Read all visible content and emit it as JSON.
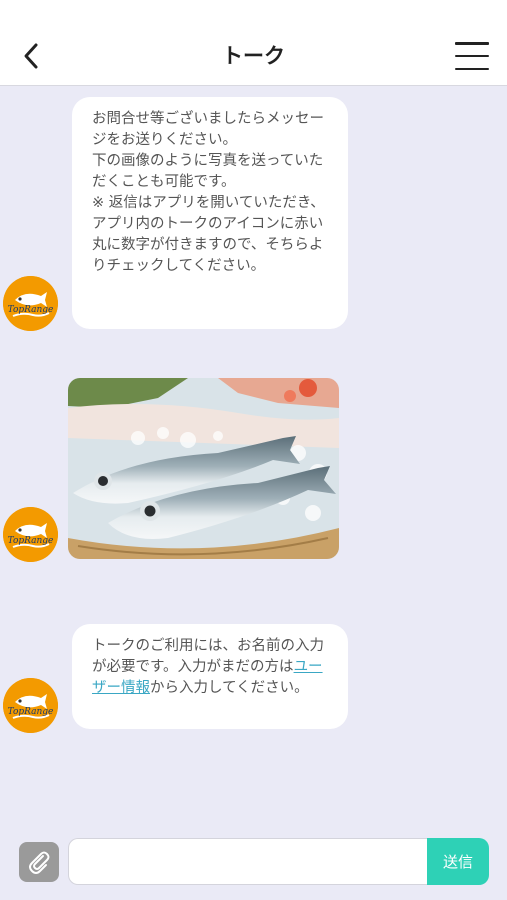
{
  "header": {
    "title": "トーク",
    "back_icon": "chevron-left-icon",
    "menu_icon": "hamburger-menu-icon"
  },
  "messages": [
    {
      "sender_logo": "TopRange",
      "text": "お問合せ等ございましたらメッセージをお送りください。\n下の画像のように写真を送っていただくことも可能です。\n※ 返信はアプリを開いていただき、アプリ内のトークのアイコンに赤い丸に数字が付きますので、そちらよりチェックしてください。"
    },
    {
      "sender_logo": "TopRange",
      "image": "fish-on-ice-photo"
    },
    {
      "sender_logo": "TopRange",
      "text_before": "トークのご利用には、お名前の入力が必要です。入力がまだの方は",
      "link_text": "ユーザー情報",
      "text_after": "から入力してください。"
    }
  ],
  "composer": {
    "attach_icon": "paperclip-icon",
    "input_value": "",
    "input_placeholder": "",
    "send_label": "送信"
  },
  "colors": {
    "background": "#eaeaf6",
    "accent": "#2ed1b6",
    "avatar": "#f39a00",
    "link": "#3aa7c4"
  }
}
